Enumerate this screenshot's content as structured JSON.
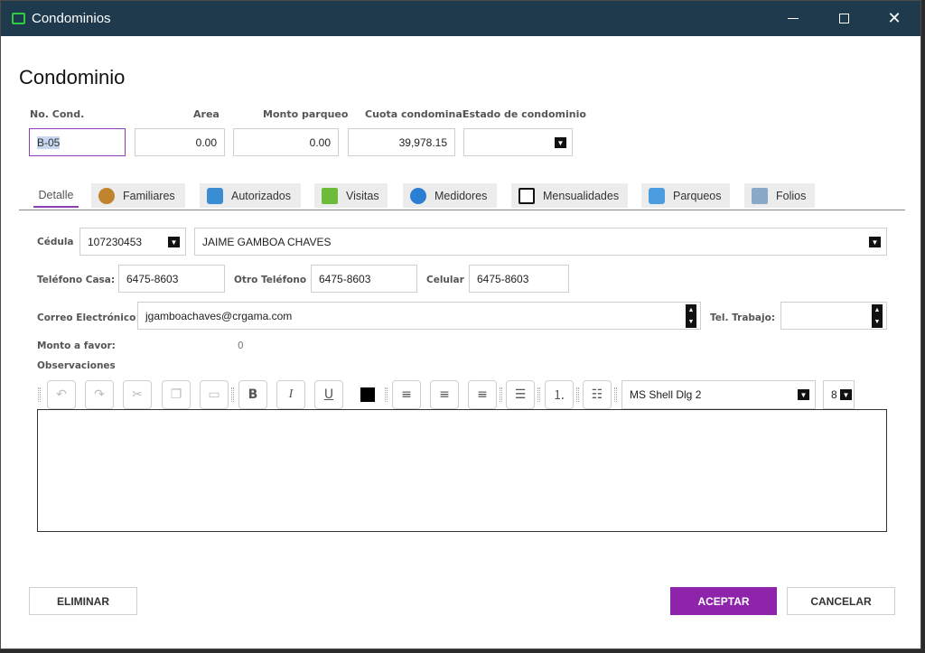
{
  "window": {
    "title": "Condominios",
    "controls": [
      "minimize-icon",
      "maximize-icon",
      "close-icon"
    ]
  },
  "form": {
    "heading": "Condominio",
    "labels": {
      "no_cond": "No. Cond.",
      "area": "Area",
      "monto_parqueo": "Monto parqueo",
      "cuota": "Cuota condominal",
      "estado": "Estado de condominio"
    },
    "values": {
      "no_cond": "B-05",
      "area": "0.00",
      "monto_parqueo": "0.00",
      "cuota": "39,978.15",
      "estado": ""
    }
  },
  "tabs": [
    {
      "label": "Detalle",
      "icon": "",
      "active": true
    },
    {
      "label": "Familiares",
      "icon": "family-icon"
    },
    {
      "label": "Autorizados",
      "icon": "authorized-icon"
    },
    {
      "label": "Visitas",
      "icon": "visits-icon"
    },
    {
      "label": "Medidores",
      "icon": "meter-icon"
    },
    {
      "label": "Mensualidades",
      "icon": "monthly-icon"
    },
    {
      "label": "Parqueos",
      "icon": "parking-icon"
    },
    {
      "label": "Folios",
      "icon": "folio-icon"
    }
  ],
  "detalle": {
    "cedula_label": "Cédula",
    "cedula": "107230453",
    "nombre": "JAIME GAMBOA CHAVES",
    "tel_casa_label": "Teléfono Casa:",
    "tel_casa": "6475-8603",
    "otro_tel_label": "Otro Teléfono",
    "otro_tel": "6475-8603",
    "celular_label": "Celular",
    "celular": "6475-8603",
    "correo_label": "Correo Electrónico",
    "correo": "jgamboachaves@crgama.com",
    "tel_trabajo_label": "Tel. Trabajo:",
    "tel_trabajo": "",
    "monto_favor_label": "Monto a favor:",
    "monto_favor": "0",
    "observaciones_label": "Observaciones"
  },
  "editor_toolbar": {
    "buttons": [
      "undo-icon",
      "redo-icon",
      "cut-icon",
      "copy-icon",
      "paste-icon",
      "bold-icon",
      "italic-icon",
      "underline-icon",
      "font-color-icon",
      "align-left-icon",
      "align-center-icon",
      "align-right-icon",
      "justify-icon",
      "numbered-list-icon",
      "bullet-list-icon"
    ],
    "bold": "B",
    "italic": "I",
    "underline": "U",
    "font": "MS Shell Dlg 2",
    "size": "8"
  },
  "buttons": {
    "eliminar": "ELIMINAR",
    "aceptar": "ACEPTAR",
    "cancelar": "CANCELAR"
  },
  "colors": {
    "titlebar": "#1e3a4c",
    "accent": "#8e24aa"
  }
}
